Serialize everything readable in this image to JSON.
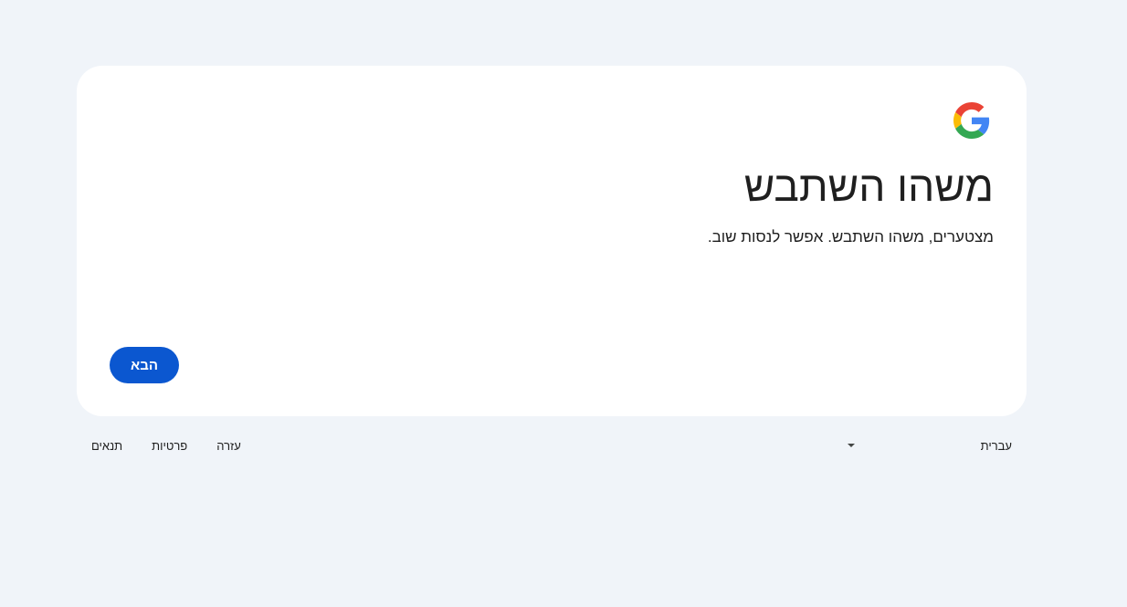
{
  "card": {
    "title": "משהו השתבש",
    "subtitle": "מצטערים, משהו השתבש. אפשר לנסות שוב.",
    "next_button_label": "הבא",
    "logo_icon": "google-g-icon"
  },
  "footer": {
    "language": "עברית",
    "links": [
      "עזרה",
      "פרטיות",
      "תנאים"
    ]
  },
  "colors": {
    "background": "#f0f4f9",
    "card": "#ffffff",
    "primary_button": "#0b57d0",
    "text": "#1f1f1f"
  }
}
